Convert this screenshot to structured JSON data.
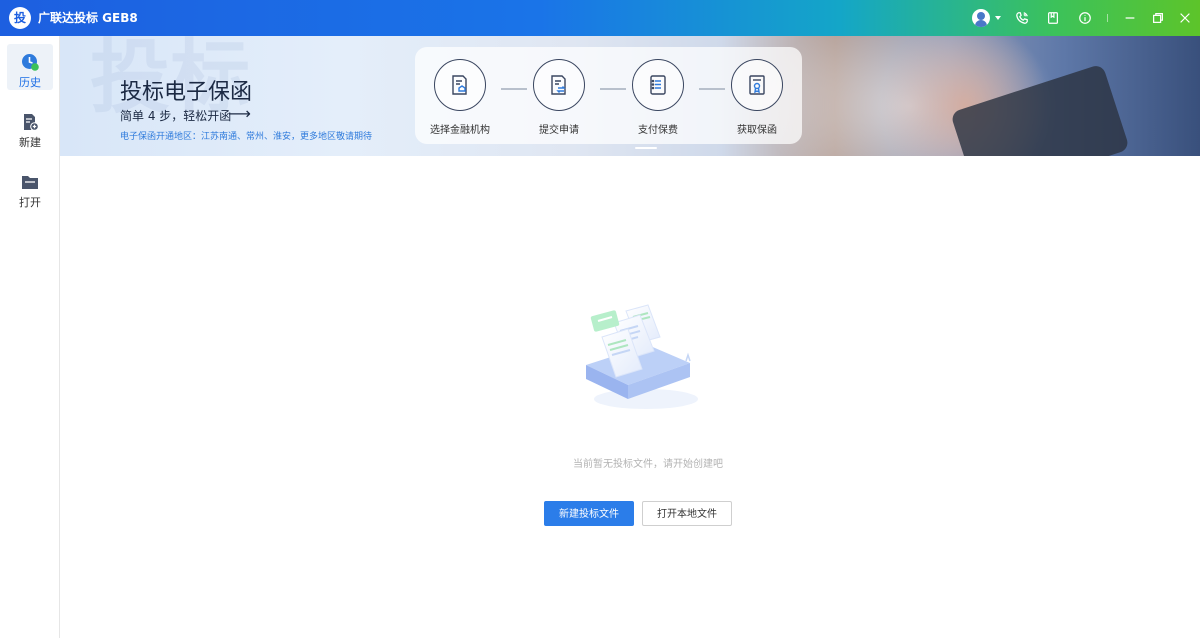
{
  "window": {
    "logo_char": "投",
    "title": "广联达投标 GEB8"
  },
  "titlebar_icons": [
    "user-avatar-icon",
    "chevron-down-icon",
    "phone-icon",
    "book-icon",
    "info-icon",
    "minimize-icon",
    "restore-icon",
    "close-icon"
  ],
  "sidebar": {
    "items": [
      {
        "label": "历史",
        "icon": "history-icon",
        "active": true
      },
      {
        "label": "新建",
        "icon": "new-file-icon",
        "active": false
      },
      {
        "label": "打开",
        "icon": "folder-icon",
        "active": false
      }
    ]
  },
  "banner": {
    "title": "投标电子保函",
    "subtitle": "简单 4 步，轻松开函",
    "arrow": "⟶",
    "region_note": "电子保函开通地区：江苏南通、常州、淮安，更多地区敬请期待",
    "steps": [
      {
        "label": "选择金融机构",
        "icon": "bank-doc-icon"
      },
      {
        "label": "提交申请",
        "icon": "submit-doc-icon"
      },
      {
        "label": "支付保费",
        "icon": "payment-icon"
      },
      {
        "label": "获取保函",
        "icon": "certificate-icon"
      }
    ]
  },
  "main": {
    "empty_message": "当前暂无投标文件，请开始创建吧",
    "new_button": "新建投标文件",
    "open_button": "打开本地文件"
  },
  "colors": {
    "accent": "#2b7de9",
    "region_text": "#2f7bdc",
    "active_side_bg": "#edf2f8"
  }
}
